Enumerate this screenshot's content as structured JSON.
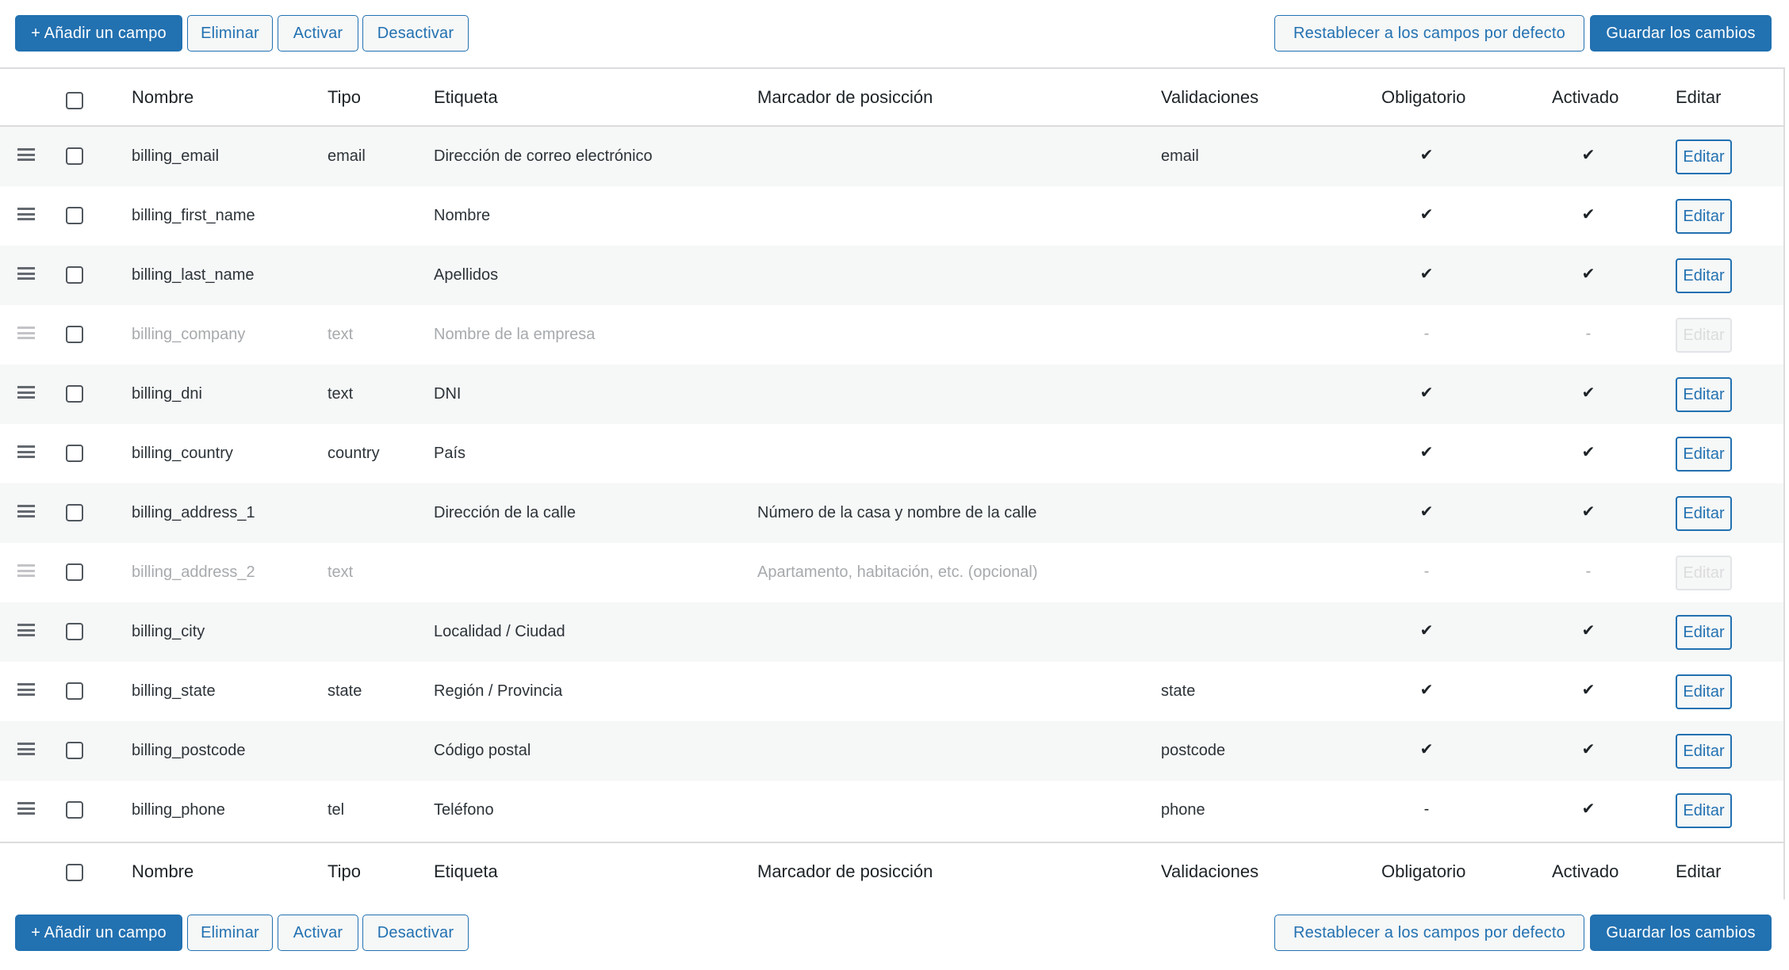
{
  "toolbar": {
    "add_field": "+ Añadir un campo",
    "remove": "Eliminar",
    "enable": "Activar",
    "disable": "Desactivar",
    "reset": "Restablecer a los campos por defecto",
    "save": "Guardar los cambios"
  },
  "columns": {
    "name": "Nombre",
    "type": "Tipo",
    "label": "Etiqueta",
    "placeholder": "Marcador de posicción",
    "validations": "Validaciones",
    "required": "Obligatorio",
    "enabled": "Activado",
    "edit": "Editar"
  },
  "rows": [
    {
      "name": "billing_email",
      "type": "email",
      "label": "Dirección de correo electrónico",
      "placeholder": "",
      "validations": "email",
      "required": "✔",
      "enabled": "✔",
      "edit": "Editar",
      "disabled": false
    },
    {
      "name": "billing_first_name",
      "type": "",
      "label": "Nombre",
      "placeholder": "",
      "validations": "",
      "required": "✔",
      "enabled": "✔",
      "edit": "Editar",
      "disabled": false
    },
    {
      "name": "billing_last_name",
      "type": "",
      "label": "Apellidos",
      "placeholder": "",
      "validations": "",
      "required": "✔",
      "enabled": "✔",
      "edit": "Editar",
      "disabled": false
    },
    {
      "name": "billing_company",
      "type": "text",
      "label": "Nombre de la empresa",
      "placeholder": "",
      "validations": "",
      "required": "-",
      "enabled": "-",
      "edit": "Editar",
      "disabled": true
    },
    {
      "name": "billing_dni",
      "type": "text",
      "label": "DNI",
      "placeholder": "",
      "validations": "",
      "required": "✔",
      "enabled": "✔",
      "edit": "Editar",
      "disabled": false
    },
    {
      "name": "billing_country",
      "type": "country",
      "label": "País",
      "placeholder": "",
      "validations": "",
      "required": "✔",
      "enabled": "✔",
      "edit": "Editar",
      "disabled": false
    },
    {
      "name": "billing_address_1",
      "type": "",
      "label": "Dirección de la calle",
      "placeholder": "Número de la casa y nombre de la calle",
      "validations": "",
      "required": "✔",
      "enabled": "✔",
      "edit": "Editar",
      "disabled": false
    },
    {
      "name": "billing_address_2",
      "type": "text",
      "label": "",
      "placeholder": "Apartamento, habitación, etc. (opcional)",
      "validations": "",
      "required": "-",
      "enabled": "-",
      "edit": "Editar",
      "disabled": true
    },
    {
      "name": "billing_city",
      "type": "",
      "label": "Localidad / Ciudad",
      "placeholder": "",
      "validations": "",
      "required": "✔",
      "enabled": "✔",
      "edit": "Editar",
      "disabled": false
    },
    {
      "name": "billing_state",
      "type": "state",
      "label": "Región / Provincia",
      "placeholder": "",
      "validations": "state",
      "required": "✔",
      "enabled": "✔",
      "edit": "Editar",
      "disabled": false
    },
    {
      "name": "billing_postcode",
      "type": "",
      "label": "Código postal",
      "placeholder": "",
      "validations": "postcode",
      "required": "✔",
      "enabled": "✔",
      "edit": "Editar",
      "disabled": false
    },
    {
      "name": "billing_phone",
      "type": "tel",
      "label": "Teléfono",
      "placeholder": "",
      "validations": "phone",
      "required": "-",
      "enabled": "✔",
      "edit": "Editar",
      "disabled": false
    }
  ],
  "icons": {
    "drag_handle": "drag-handle-icon",
    "checkmark": "checkmark-icon"
  },
  "colors": {
    "primary": "#2271b1",
    "row_alt": "#f6f7f7",
    "disabled_text": "#a7aaad"
  }
}
